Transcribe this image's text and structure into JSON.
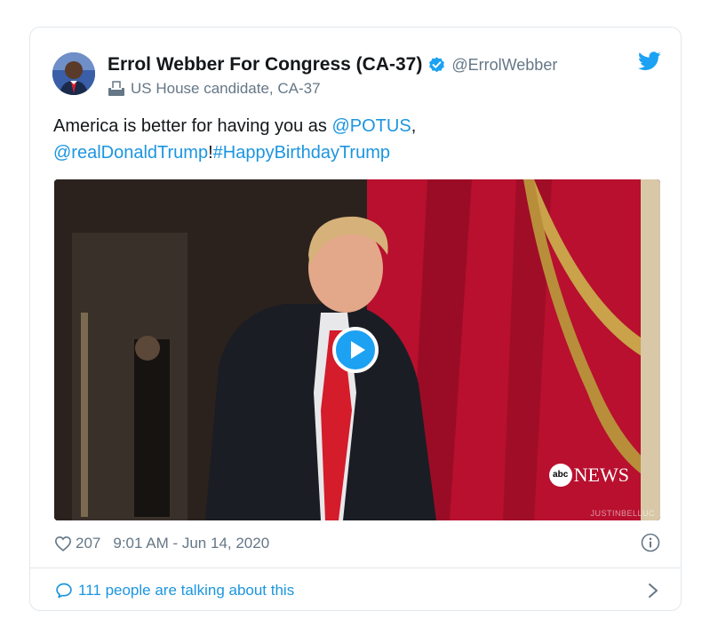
{
  "author": {
    "display_name": "Errol Webber For Congress (CA-37)",
    "handle": "@ErrolWebber",
    "label": "US House candidate, CA-37"
  },
  "tweet": {
    "text_plain": "America is better for having you as ",
    "mention_potus": "@POTUS",
    "comma": ",",
    "mention_trump": "@realDonaldTrump",
    "bang": "!",
    "hashtag": "#HappyBirthdayTrump"
  },
  "media": {
    "watermark_brand": "abc",
    "watermark_text": "NEWS",
    "credit": "JUSTINBELLUC"
  },
  "meta": {
    "like_count": "207",
    "timestamp": "9:01 AM - Jun 14, 2020"
  },
  "footer": {
    "talking_text": "111 people are talking about this"
  },
  "colors": {
    "link": "#1b95e0",
    "text": "#14171a",
    "muted": "#657786",
    "border": "#e1e8ed",
    "twitter_blue": "#1da1f2"
  },
  "icons": {
    "verified": "verified-badge-icon",
    "ballot": "ballot-box-icon",
    "twitter": "twitter-bird-icon",
    "play": "play-icon",
    "heart": "heart-icon",
    "info": "info-icon",
    "reply": "speech-bubble-icon",
    "chevron": "chevron-right-icon"
  }
}
